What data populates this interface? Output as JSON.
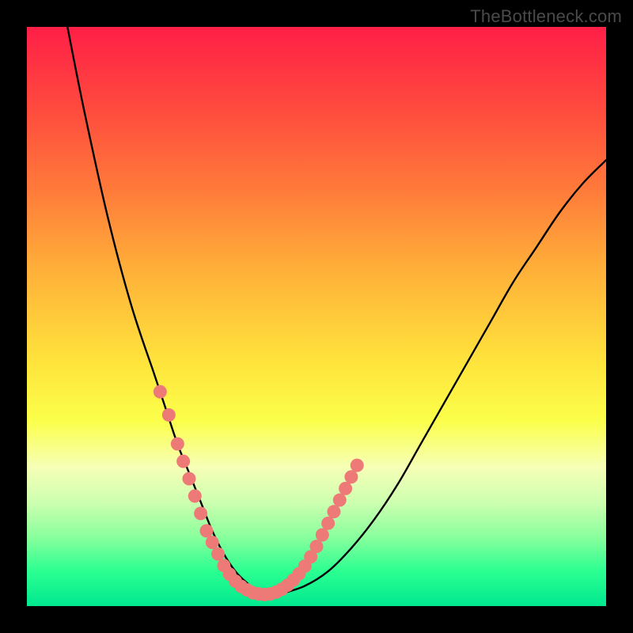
{
  "watermark": "TheBottleneck.com",
  "chart_data": {
    "type": "line",
    "title": "",
    "xlabel": "",
    "ylabel": "",
    "xlim": [
      0,
      100
    ],
    "ylim": [
      0,
      100
    ],
    "series": [
      {
        "name": "bottleneck-curve",
        "x": [
          7,
          10,
          14,
          18,
          22,
          24,
          26,
          28,
          30,
          32,
          34,
          36,
          38,
          40,
          42,
          44,
          48,
          52,
          56,
          60,
          64,
          68,
          72,
          76,
          80,
          84,
          88,
          92,
          96,
          100
        ],
        "values": [
          100,
          85,
          67,
          52,
          40,
          34,
          28,
          23,
          18,
          13,
          9,
          6,
          4,
          2.5,
          2,
          2.2,
          3.5,
          6,
          10,
          15,
          21,
          28,
          35,
          42,
          49,
          56,
          62,
          68,
          73,
          77
        ]
      }
    ],
    "markers": {
      "name": "highlighted-points",
      "color": "#ee7a77",
      "points": [
        {
          "x": 23,
          "y": 37
        },
        {
          "x": 24.5,
          "y": 33
        },
        {
          "x": 26,
          "y": 28
        },
        {
          "x": 27,
          "y": 25
        },
        {
          "x": 28,
          "y": 22
        },
        {
          "x": 29,
          "y": 19
        },
        {
          "x": 30,
          "y": 16
        },
        {
          "x": 31,
          "y": 13
        },
        {
          "x": 32,
          "y": 11
        },
        {
          "x": 33,
          "y": 9
        },
        {
          "x": 34,
          "y": 7
        },
        {
          "x": 35,
          "y": 5.5
        },
        {
          "x": 36,
          "y": 4.3
        },
        {
          "x": 37,
          "y": 3.4
        },
        {
          "x": 38,
          "y": 2.8
        },
        {
          "x": 39,
          "y": 2.3
        },
        {
          "x": 40,
          "y": 2.1
        },
        {
          "x": 41,
          "y": 2.0
        },
        {
          "x": 42,
          "y": 2.1
        },
        {
          "x": 43,
          "y": 2.4
        },
        {
          "x": 44,
          "y": 2.9
        },
        {
          "x": 45,
          "y": 3.6
        },
        {
          "x": 46,
          "y": 4.5
        },
        {
          "x": 47,
          "y": 5.6
        },
        {
          "x": 48,
          "y": 6.9
        },
        {
          "x": 49,
          "y": 8.5
        },
        {
          "x": 50,
          "y": 10.3
        },
        {
          "x": 51,
          "y": 12.3
        },
        {
          "x": 52,
          "y": 14.3
        },
        {
          "x": 53,
          "y": 16.3
        },
        {
          "x": 54,
          "y": 18.3
        },
        {
          "x": 55,
          "y": 20.3
        },
        {
          "x": 56,
          "y": 22.3
        },
        {
          "x": 57,
          "y": 24.3
        }
      ]
    }
  }
}
